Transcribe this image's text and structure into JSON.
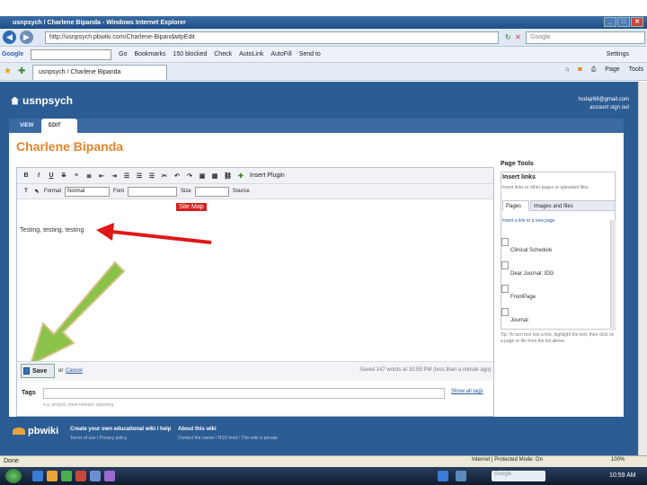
{
  "browser": {
    "window_title": "usnpsych / Charlene Bipanda - Windows Internet Explorer",
    "url": "http://usnpsych.pbwiki.com/Charlene-Bipanda#pEdit",
    "search_placeholder": "Google",
    "google_label": "Google",
    "google_items": [
      "Go",
      "Bookmarks",
      "150 blocked",
      "Check",
      "AutoLink",
      "AutoFill",
      "Send to"
    ],
    "settings_label": "Settings",
    "tab_label": "usnpsych / Charlene Bipanda",
    "page_menu": "Page",
    "tools_menu": "Tools"
  },
  "site": {
    "logo": "usnpsych",
    "user_email": "hcdajr68@gmail.com",
    "user_links": "account  sign out",
    "tab_view": "VIEW",
    "tab_edit": "EDIT",
    "page_title": "Charlene Bipanda"
  },
  "editor": {
    "toolbar1": [
      "B",
      "I",
      "U",
      "S"
    ],
    "insert_plugin": "Insert Plugin",
    "format_label": "Format",
    "format_value": "Normal",
    "font_label": "Font",
    "size_label": "Size",
    "source_label": "Source",
    "site_map": "Site Map",
    "body_text": "Testing, testing, testing",
    "save_label": "Save",
    "or_label": "or",
    "cancel_label": "Cancel",
    "saved_status": "Saved 147 words at 10:59 PM (less than a minute ago)",
    "tags_label": "Tags",
    "tags_hint": "e.g. project, meet release, planning",
    "show_all_tags": "Show all tags"
  },
  "page_tools": {
    "title": "Page Tools",
    "insert_links": "Insert links",
    "help": "Insert links to other pages or uploaded files.",
    "tab_pages": "Pages",
    "tab_images": "Images and files",
    "new_page_link": "Insert a link to a new page",
    "items": [
      "Clinical Schedule",
      "Dear Journal: IDG",
      "FrontPage",
      "Journal"
    ],
    "tip": "Tip: To turn text into a link, highlight the text, then click on a page or file from the list above."
  },
  "footer": {
    "brand": "pbwiki",
    "col1_title": "Create your own educational wiki / help",
    "col1_sub": "Terms of use / Privacy policy",
    "col2_title": "About this wiki",
    "col2_sub": "Contact the owner / RSS feed / This wiki is private"
  },
  "status": {
    "left": "Done",
    "protected": "Internet | Protected Mode: On",
    "zoom": "100%"
  },
  "taskbar": {
    "search_placeholder": "Google",
    "clock": "10:59 AM"
  }
}
